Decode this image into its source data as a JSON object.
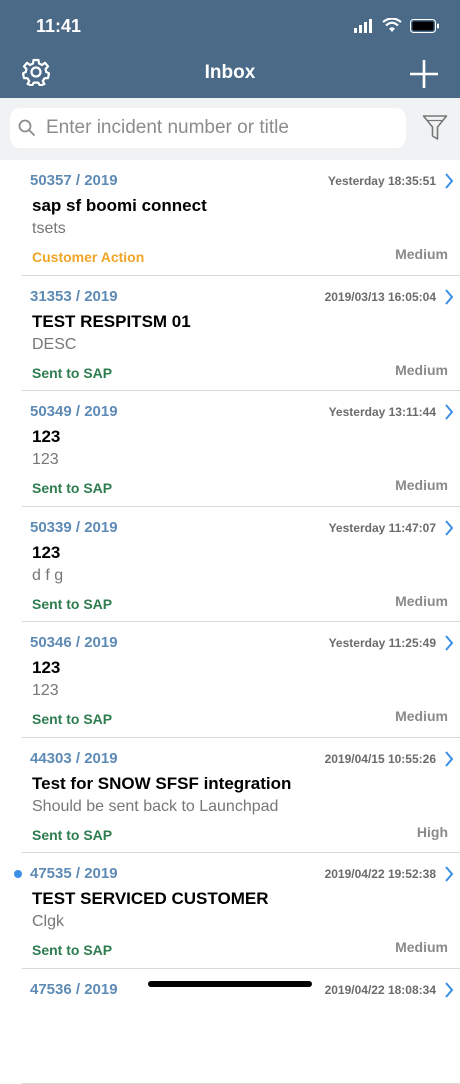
{
  "status_bar": {
    "time": "11:41"
  },
  "header": {
    "title": "Inbox"
  },
  "search": {
    "placeholder": "Enter incident number or title"
  },
  "colors": {
    "header_bg": "#4a6a87",
    "customer_action": "#f0a526",
    "sent_to_sap": "#2e7d4f",
    "number": "#5e8bb5"
  },
  "items": [
    {
      "number": "50357 / 2019",
      "date": "Yesterday 18:35:51",
      "title": "sap sf boomi connect",
      "description": "tsets",
      "status": "Customer Action",
      "status_color": "#f0a526",
      "priority": "Medium",
      "unread": false
    },
    {
      "number": "31353 / 2019",
      "date": "2019/03/13 16:05:04",
      "title": "TEST RESPITSM 01",
      "description": "DESC",
      "status": "Sent to SAP",
      "status_color": "#2e7d4f",
      "priority": "Medium",
      "unread": false
    },
    {
      "number": "50349 / 2019",
      "date": "Yesterday 13:11:44",
      "title": "123",
      "description": "123",
      "status": "Sent to SAP",
      "status_color": "#2e7d4f",
      "priority": "Medium",
      "unread": false
    },
    {
      "number": "50339 / 2019",
      "date": "Yesterday 11:47:07",
      "title": "123",
      "description": "d f g",
      "status": "Sent to SAP",
      "status_color": "#2e7d4f",
      "priority": "Medium",
      "unread": false
    },
    {
      "number": "50346 / 2019",
      "date": "Yesterday 11:25:49",
      "title": "123",
      "description": "123",
      "status": "Sent to SAP",
      "status_color": "#2e7d4f",
      "priority": "Medium",
      "unread": false
    },
    {
      "number": "44303 / 2019",
      "date": "2019/04/15 10:55:26",
      "title": "Test for SNOW SFSF integration",
      "description": "Should be sent back to Launchpad",
      "status": "Sent to SAP",
      "status_color": "#2e7d4f",
      "priority": "High",
      "unread": false
    },
    {
      "number": "47535 / 2019",
      "date": "2019/04/22 19:52:38",
      "title": "TEST SERVICED CUSTOMER",
      "description": "Clgk",
      "status": "Sent to SAP",
      "status_color": "#2e7d4f",
      "priority": "Medium",
      "unread": true
    },
    {
      "number": "47536 / 2019",
      "date": "2019/04/22 18:08:34",
      "title": "",
      "description": "",
      "status": "",
      "status_color": "#2e7d4f",
      "priority": "",
      "unread": false
    }
  ]
}
